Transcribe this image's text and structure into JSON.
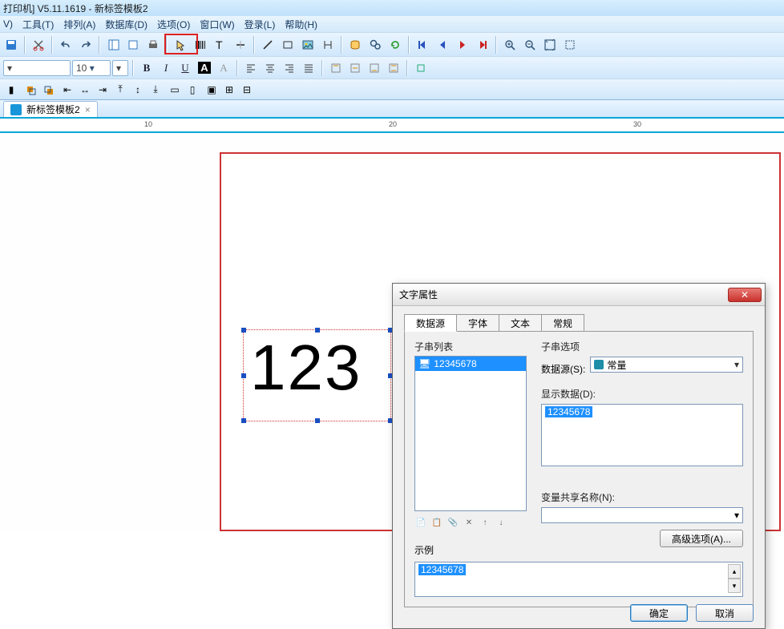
{
  "title_bar": "打印机]  V5.11.1619   - 新标签模板2",
  "menu": {
    "i0": "V)",
    "i1": "工具(T)",
    "i2": "排列(A)",
    "i3": "数据库(D)",
    "i4": "选项(O)",
    "i5": "窗口(W)",
    "i6": "登录(L)",
    "i7": "帮助(H)"
  },
  "fmt": {
    "fontsize": "10",
    "fontsize_suffix": "▾",
    "font_dd": "▾"
  },
  "doctab": {
    "label": "新标签模板2",
    "close": "×"
  },
  "ruler": {
    "t10": "10",
    "t20": "20",
    "t30": "30"
  },
  "canvas_text": "123",
  "dialog": {
    "title": "文字属性",
    "tabs": {
      "t0": "数据源",
      "t1": "字体",
      "t2": "文本",
      "t3": "常规"
    },
    "substr_list_label": "子串列表",
    "substr_item": "12345678",
    "substr_opts_label": "子串选项",
    "datasource_label": "数据源(S):",
    "datasource_value": "常量",
    "displaydata_label": "显示数据(D):",
    "displaydata_value": "12345678",
    "varname_label": "变量共享名称(N):",
    "advanced_btn": "高级选项(A)...",
    "example_label": "示例",
    "example_value": "12345678",
    "ok": "确定",
    "cancel": "取消"
  }
}
